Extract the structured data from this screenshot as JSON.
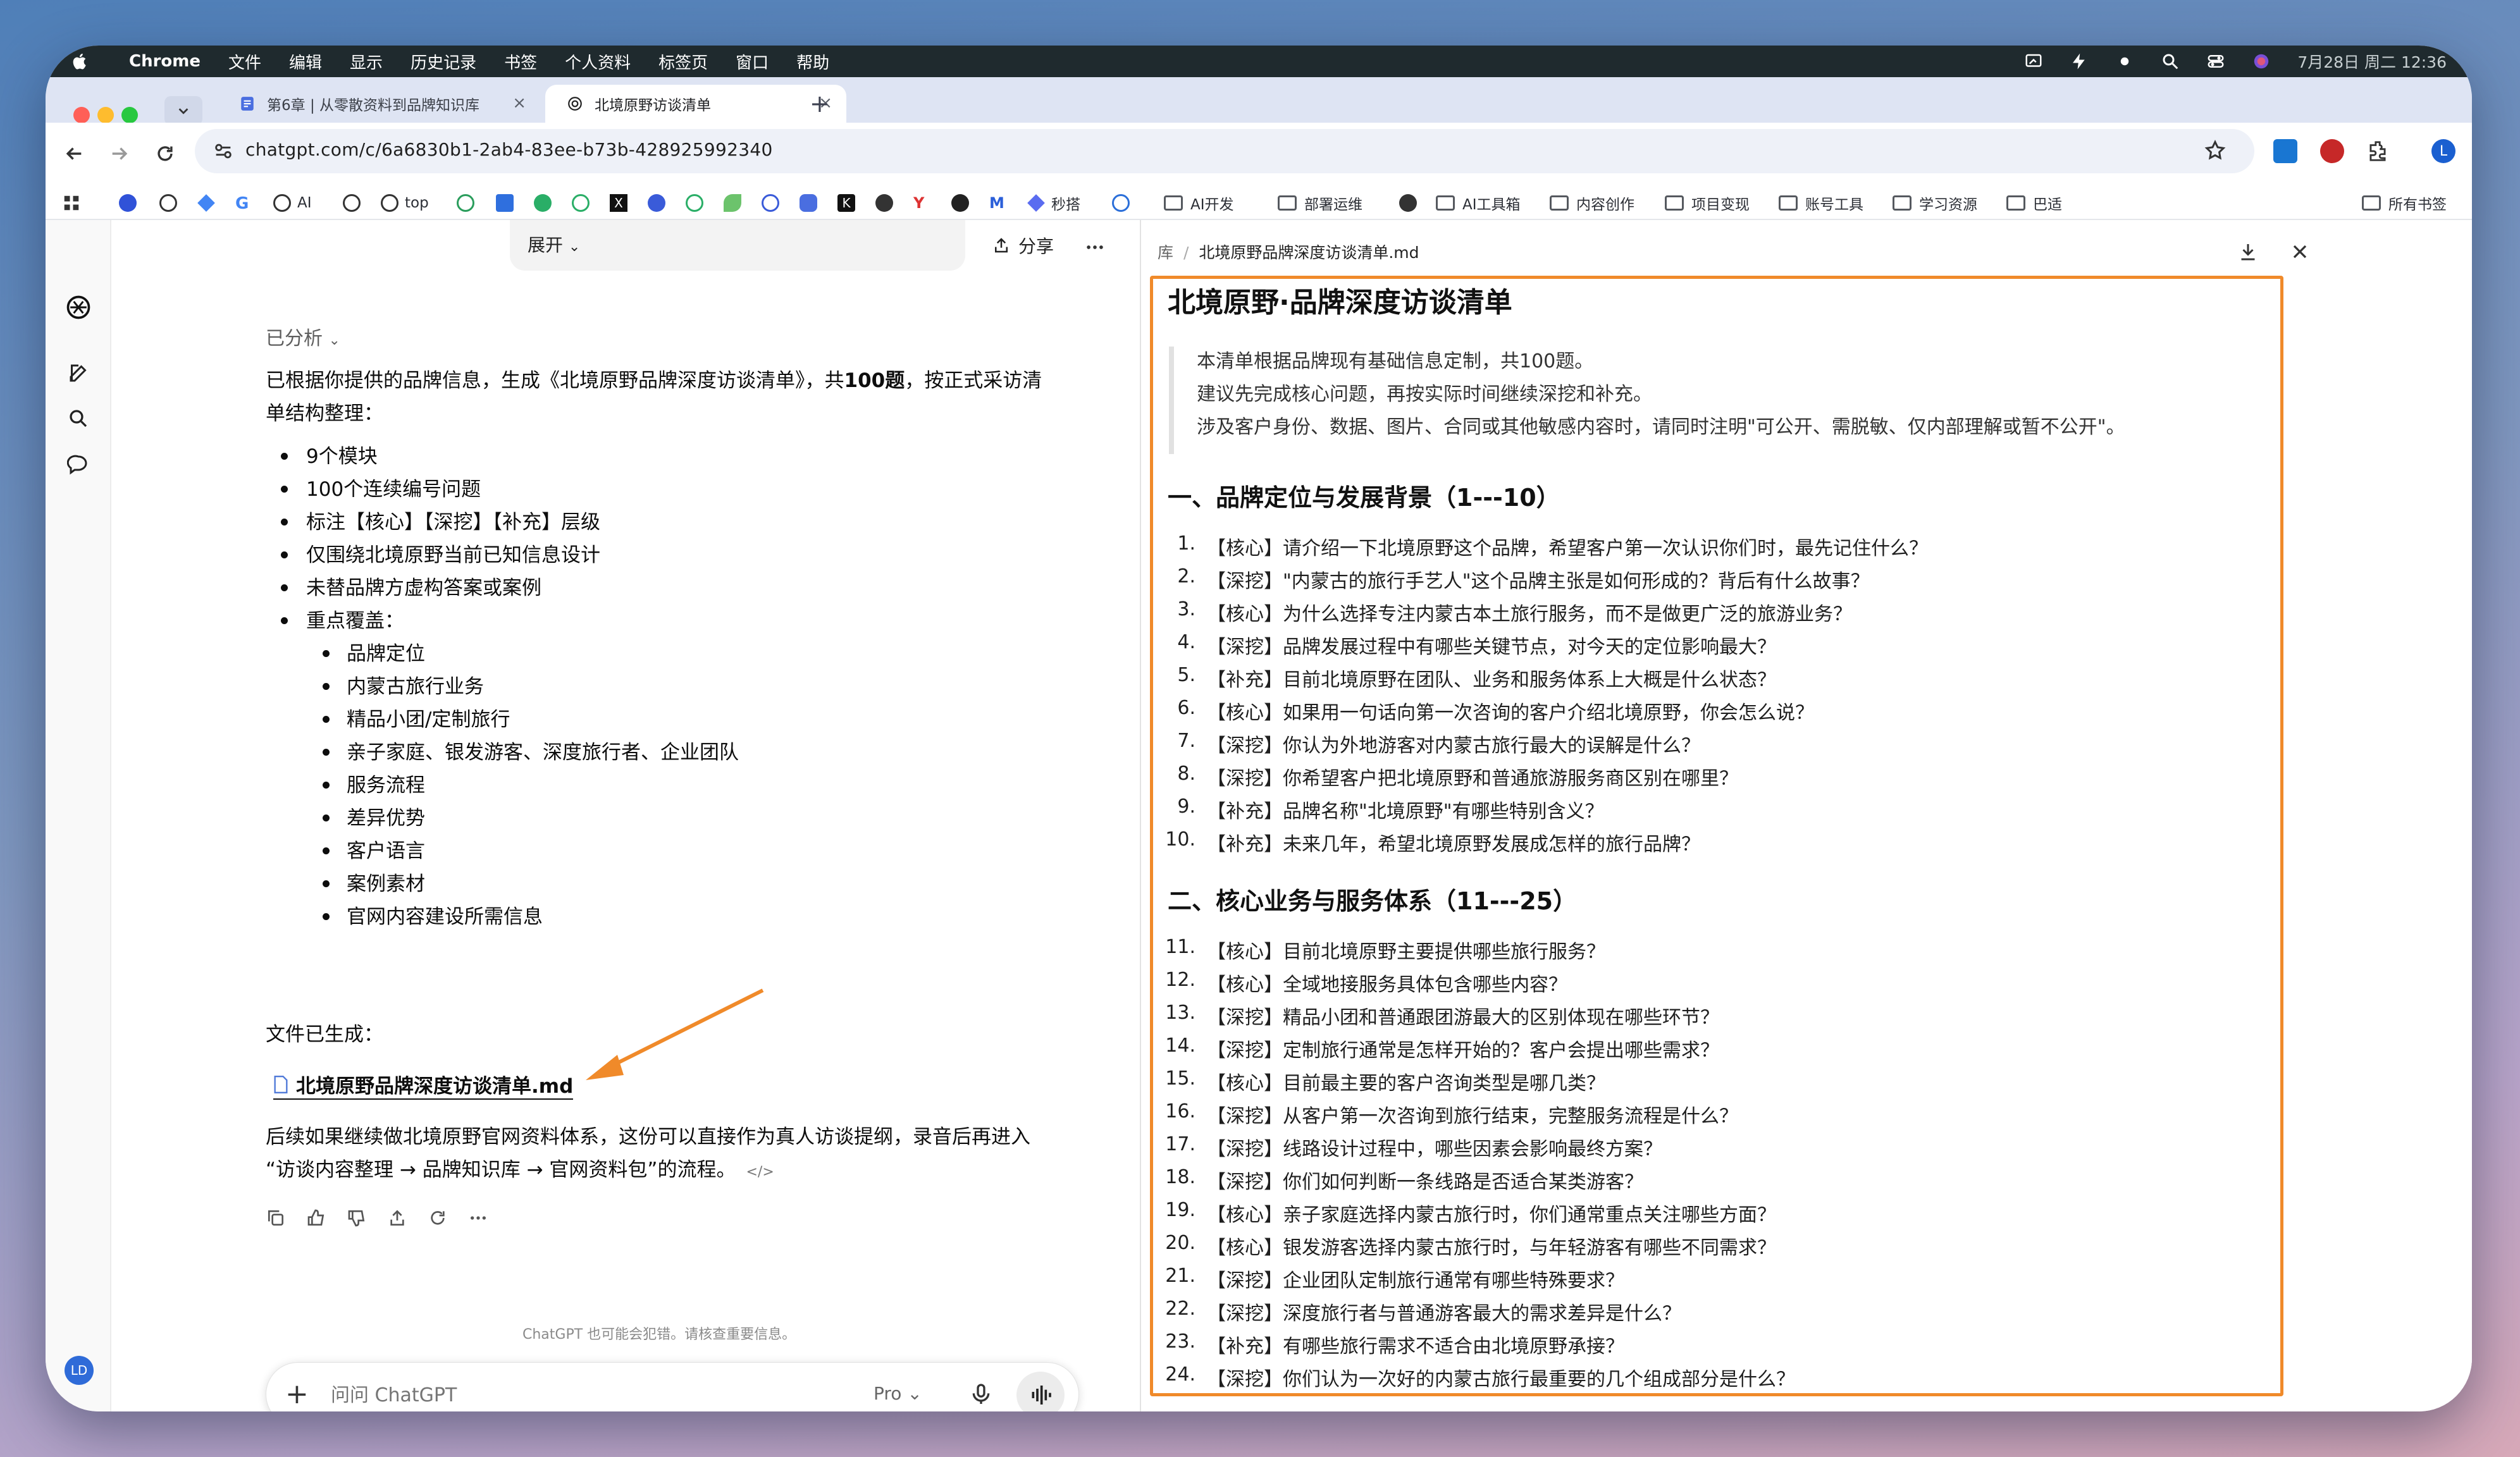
{
  "menubar": {
    "app": "Chrome",
    "items": [
      "文件",
      "编辑",
      "显示",
      "历史记录",
      "书签",
      "个人资料",
      "标签页",
      "窗口",
      "帮助"
    ],
    "clock": "7月28日 周二 12:36"
  },
  "tabs": [
    {
      "title": "第6章 | 从零散资料到品牌知识库"
    },
    {
      "title": "北境原野访谈清单"
    }
  ],
  "address": {
    "url": "chatgpt.com/c/6a6830b1-2ab4-83ee-b73b-428925992340"
  },
  "bookmarks": {
    "items": [
      "AI",
      "top",
      "秒搭",
      "AI开发",
      "部署运维",
      "AI工具箱",
      "内容创作",
      "项目变现",
      "账号工具",
      "学习资源",
      "巴适"
    ],
    "all": "所有书签"
  },
  "rail": {
    "avatar": "LD"
  },
  "chat": {
    "expand_label": "展开",
    "share_label": "分享",
    "analyzed_label": "已分析",
    "intro_1": "已根据你提供的品牌信息，生成《北境原野品牌深度访谈清单》，共",
    "intro_bold": "100题",
    "intro_2": "，按正式采访清",
    "intro_3": "单结构整理：",
    "bullets": [
      "9个模块",
      "100个连续编号问题",
      "标注【核心】【深挖】【补充】层级",
      "仅围绕北境原野当前已知信息设计",
      "未替品牌方虚构答案或案例",
      "重点覆盖："
    ],
    "sub_bullets": [
      "品牌定位",
      "内蒙古旅行业务",
      "精品小团/定制旅行",
      "亲子家庭、银发游客、深度旅行者、企业团队",
      "服务流程",
      "差异优势",
      "客户语言",
      "案例素材",
      "官网内容建设所需信息"
    ],
    "file_generated": "文件已生成：",
    "file_name": "北境原野品牌深度访谈清单.md",
    "followup_1": "后续如果继续做北境原野官网资料体系，这份可以直接作为真人访谈提纲，录音后再进入",
    "followup_2": "“访谈内容整理 → 品牌知识库 → 官网资料包”的流程。",
    "disclaimer": "ChatGPT 也可能会犯错。请核查重要信息。",
    "input_placeholder": "问问 ChatGPT",
    "model_label": "Pro"
  },
  "doc": {
    "breadcrumb_root": "库",
    "breadcrumb_file": "北境原野品牌深度访谈清单.md",
    "title": "北境原野·品牌深度访谈清单",
    "quote": [
      "本清单根据品牌现有基础信息定制，共100题。",
      "建议先完成核心问题，再按实际时间继续深挖和补充。",
      "涉及客户身份、数据、图片、合同或其他敏感内容时，请同时注明\"可公开、需脱敏、仅内部理解或暂不公开\"。"
    ],
    "section1": "一、品牌定位与发展背景（1---10）",
    "questions1": [
      "【核心】请介绍一下北境原野这个品牌，希望客户第一次认识你们时，最先记住什么？",
      "【深挖】\"内蒙古的旅行手艺人\"这个品牌主张是如何形成的？背后有什么故事？",
      "【核心】为什么选择专注内蒙古本土旅行服务，而不是做更广泛的旅游业务？",
      "【深挖】品牌发展过程中有哪些关键节点，对今天的定位影响最大？",
      "【补充】目前北境原野在团队、业务和服务体系上大概是什么状态？",
      "【核心】如果用一句话向第一次咨询的客户介绍北境原野，你会怎么说？",
      "【深挖】你认为外地游客对内蒙古旅行最大的误解是什么？",
      "【深挖】你希望客户把北境原野和普通旅游服务商区别在哪里？",
      "【补充】品牌名称\"北境原野\"有哪些特别含义？",
      "【补充】未来几年，希望北境原野发展成怎样的旅行品牌？"
    ],
    "section2": "二、核心业务与服务体系（11---25）",
    "questions2": [
      "【核心】目前北境原野主要提供哪些旅行服务？",
      "【核心】全域地接服务具体包含哪些内容？",
      "【深挖】精品小团和普通跟团游最大的区别体现在哪些环节？",
      "【深挖】定制旅行通常是怎样开始的？客户会提出哪些需求？",
      "【核心】目前最主要的客户咨询类型是哪几类？",
      "【深挖】从客户第一次咨询到旅行结束，完整服务流程是什么？",
      "【深挖】线路设计过程中，哪些因素会影响最终方案？",
      "【深挖】你们如何判断一条线路是否适合某类游客？",
      "【核心】亲子家庭选择内蒙古旅行时，你们通常重点关注哪些方面？",
      "【核心】银发游客选择内蒙古旅行时，与年轻游客有哪些不同需求？",
      "【深挖】企业团队定制旅行通常有哪些特殊要求？",
      "【深挖】深度旅行者与普通游客最大的需求差异是什么？",
      "【补充】有哪些旅行需求不适合由北境原野承接？",
      "【深挖】你们认为一次好的内蒙古旅行最重要的几个组成部分是什么？"
    ]
  },
  "colors": {
    "highlight_border": "#f08a2a",
    "arrow": "#f08a2a"
  }
}
